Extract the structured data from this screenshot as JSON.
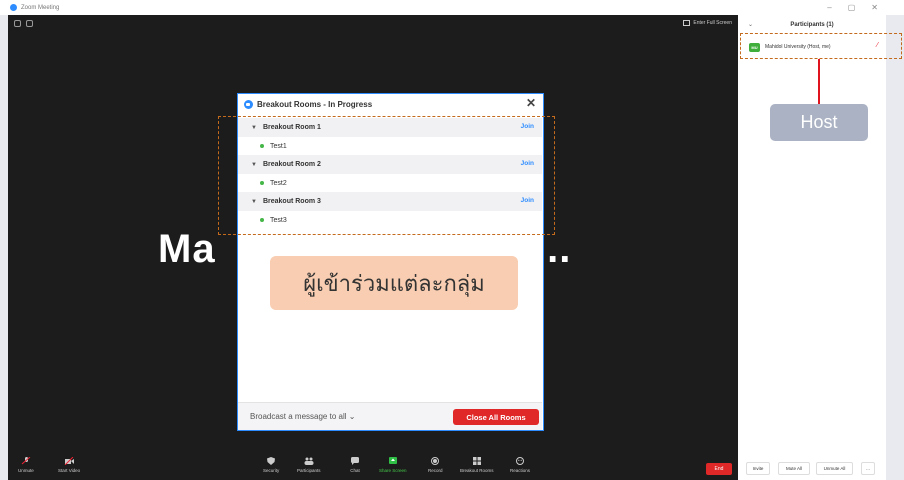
{
  "window": {
    "title": "Zoom Meeting",
    "controls": [
      "–",
      "▢",
      "✕"
    ]
  },
  "stage": {
    "enter_full_screen": "Enter Full Screen",
    "participant_name_display": "Ma",
    "participant_name_tail": "..."
  },
  "toolbar": {
    "left": [
      {
        "label": "Unmute",
        "icon": "mic-muted-icon"
      },
      {
        "label": "Start Video",
        "icon": "video-off-icon"
      }
    ],
    "center": [
      {
        "label": "Security",
        "icon": "shield-icon"
      },
      {
        "label": "Participants",
        "icon": "participants-icon",
        "count": "1"
      },
      {
        "label": "Chat",
        "icon": "chat-icon"
      },
      {
        "label": "Share Screen",
        "icon": "share-screen-icon"
      },
      {
        "label": "Record",
        "icon": "record-icon"
      },
      {
        "label": "Breakout Rooms",
        "icon": "breakout-rooms-icon"
      },
      {
        "label": "Reactions",
        "icon": "reactions-icon"
      }
    ],
    "end": "End"
  },
  "participants_panel": {
    "title": "Participants (1)",
    "participant": {
      "initials": "MU",
      "name": "Mahidol University (Host, me)"
    },
    "buttons": {
      "invite": "Invite",
      "mute_all": "Mute All",
      "unmute_all": "Unmute All",
      "more": "..."
    }
  },
  "breakout_dialog": {
    "title": "Breakout Rooms - In Progress",
    "rooms": [
      {
        "name": "Breakout Room 1",
        "join": "Join",
        "members": [
          "Test1"
        ]
      },
      {
        "name": "Breakout Room 2",
        "join": "Join",
        "members": [
          "Test2"
        ]
      },
      {
        "name": "Breakout Room 3",
        "join": "Join",
        "members": [
          "Test3"
        ]
      }
    ],
    "broadcast": "Broadcast a message to all",
    "close_all": "Close All Rooms"
  },
  "annotations": {
    "host_label": "Host",
    "members_label": "ผู้เข้าร่วมแต่ละกลุ่ม"
  },
  "colors": {
    "accent": "#2d8cff",
    "danger": "#e02828",
    "annotation_border": "#c46a1c",
    "host_callout": "#aab2c3",
    "members_callout": "#f8cdb1"
  }
}
